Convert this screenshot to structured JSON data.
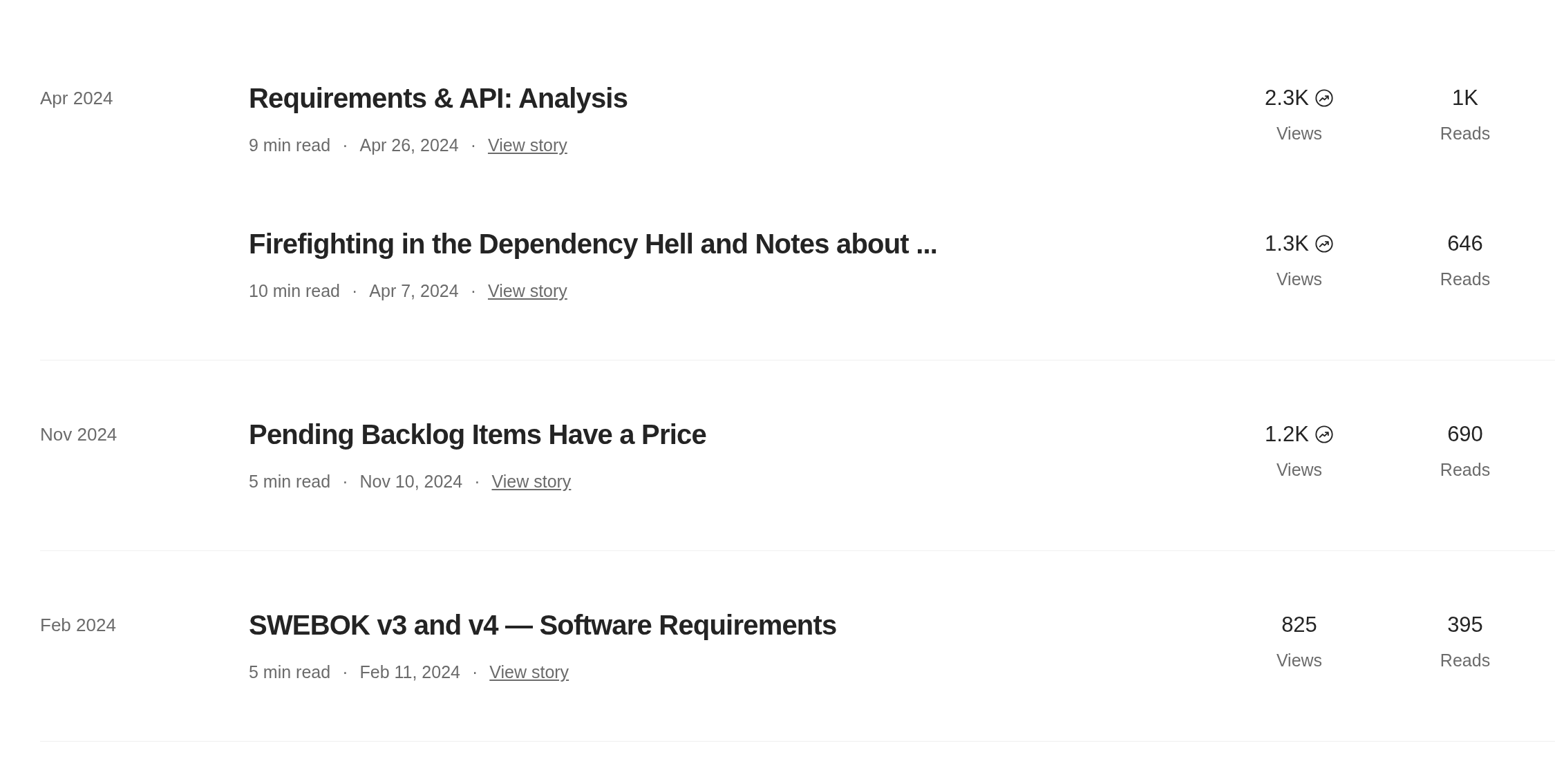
{
  "groups": [
    {
      "month": "Apr 2024",
      "stories": [
        {
          "title": "Requirements & API: Analysis",
          "read_time": "9 min read",
          "sep_1": "·",
          "date": "Apr 26, 2024",
          "sep_2": "·",
          "link": "View story",
          "views": "2.3K",
          "trending": true,
          "views_label": "Views",
          "reads": "1K",
          "reads_label": "Reads"
        },
        {
          "title": "Firefighting in the Dependency Hell and Notes about ...",
          "read_time": "10 min read",
          "sep_1": "·",
          "date": "Apr 7, 2024",
          "sep_2": "·",
          "link": "View story",
          "views": "1.3K",
          "trending": true,
          "views_label": "Views",
          "reads": "646",
          "reads_label": "Reads"
        }
      ]
    },
    {
      "month": "Nov 2024",
      "stories": [
        {
          "title": "Pending Backlog Items Have a Price",
          "read_time": "5 min read",
          "sep_1": "·",
          "date": "Nov 10, 2024",
          "sep_2": "·",
          "link": "View story",
          "views": "1.2K",
          "trending": true,
          "views_label": "Views",
          "reads": "690",
          "reads_label": "Reads"
        }
      ]
    },
    {
      "month": "Feb 2024",
      "stories": [
        {
          "title": "SWEBOK v3 and v4 — Software Requirements",
          "read_time": "5 min read",
          "sep_1": "·",
          "date": "Feb 11, 2024",
          "sep_2": "·",
          "link": "View story",
          "views": "825",
          "trending": false,
          "views_label": "Views",
          "reads": "395",
          "reads_label": "Reads"
        }
      ]
    }
  ]
}
